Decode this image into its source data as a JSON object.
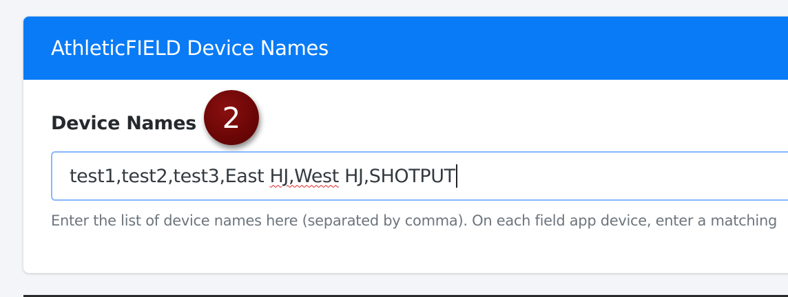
{
  "card": {
    "title": "AthleticFIELD Device Names",
    "header_color": "#0a7bf6"
  },
  "field": {
    "label": "Device Names",
    "value_parts": [
      "test1,test2,test3,East ",
      "HJ",
      ",West",
      " HJ,SHOTPUT"
    ],
    "help": "Enter the list of device names here (separated by comma). On each field app device, enter a matching"
  },
  "badge": {
    "number": "2",
    "color": "#6b0606"
  }
}
